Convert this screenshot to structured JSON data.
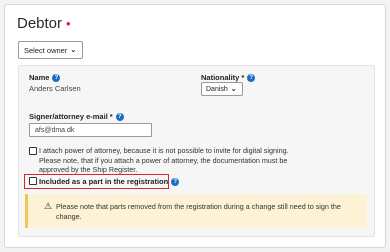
{
  "section": {
    "title": "Debtor",
    "required_marker": "•",
    "owner_select": "Select owner"
  },
  "fields": {
    "name_label": "Name",
    "name_value": "Anders Carlsen",
    "nationality_label": "Nationality",
    "nationality_required": "*",
    "nationality_value": "Danish",
    "email_label": "Signer/attorney e-mail",
    "email_required": "*",
    "email_value": "afs@dma.dk"
  },
  "checkboxes": {
    "power_of_attorney": "I attach power of attorney, because it is not possible to invite for digital signing. Please note, that if you attach a power of attorney, the documentation must be approved by the Ship Register.",
    "included_label": "Included as a part in the registration"
  },
  "warning": {
    "text": "Please note that parts removed from the registration during a change still need to sign the change."
  },
  "colors": {
    "accent": "#1a6dc5",
    "required": "#e0144c",
    "highlight_border": "#d9262b",
    "warning_bg": "#fdf1d6",
    "warning_bar": "#f1c75b"
  },
  "icons": {
    "help": "question-circle-icon",
    "warning": "warning-triangle-icon",
    "dropdown": "chevron-down-icon"
  }
}
